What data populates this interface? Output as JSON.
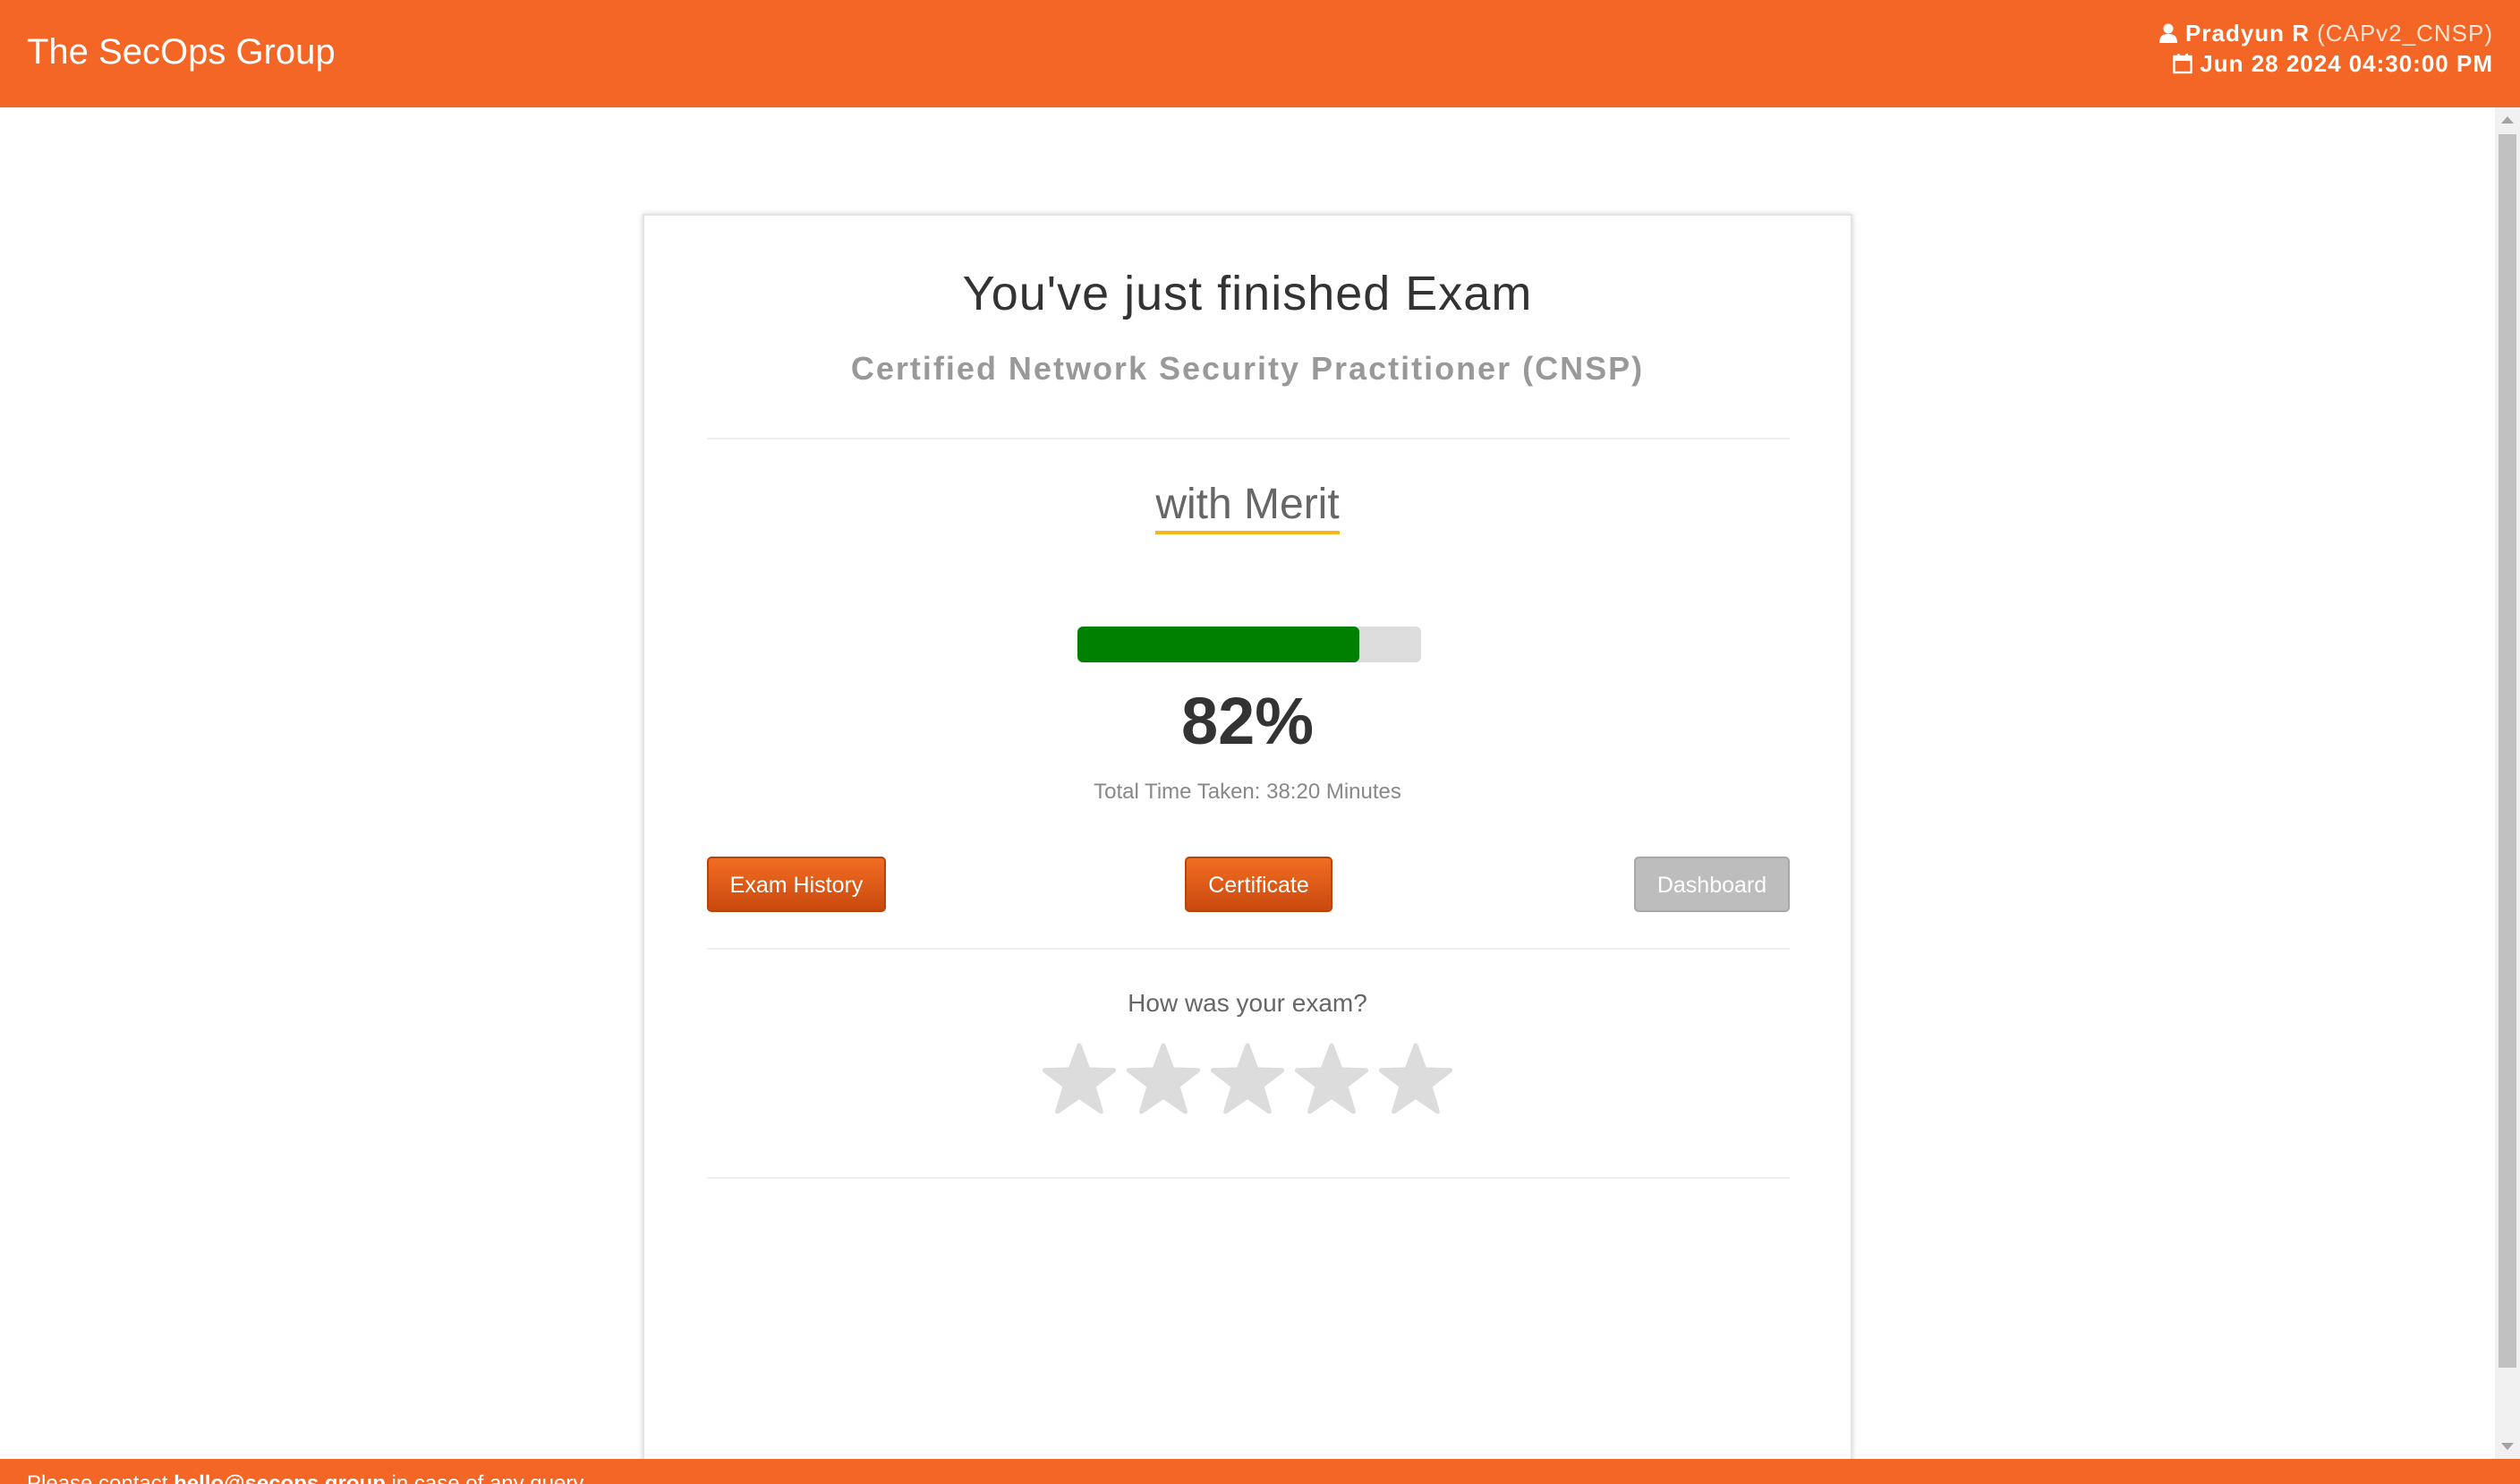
{
  "header": {
    "brand": "The SecOps Group",
    "user_name": "Pradyun R",
    "user_role": "(CAPv2_CNSP)",
    "date": "Jun 28 2024",
    "time": "04:30:00 PM",
    "user_icon": "user-icon",
    "calendar_icon": "calendar-icon",
    "bg_color": "#f46625"
  },
  "result": {
    "title": "You've just finished Exam",
    "exam_name": "Certified Network Security Practitioner (CNSP)",
    "grade": "with Merit",
    "score_percent": 82,
    "score_label": "82%",
    "time_taken": "Total Time Taken: 38:20 Minutes",
    "progress_color": "#008000"
  },
  "buttons": {
    "history": "Exam History",
    "certificate": "Certificate",
    "dashboard": "Dashboard"
  },
  "rating": {
    "question": "How was your exam?",
    "max_stars": 5,
    "selected": 0,
    "star_icon": "star-icon"
  },
  "footer": {
    "prefix": "Please contact",
    "email": "hello@secops.group",
    "suffix": "in case of any query"
  }
}
